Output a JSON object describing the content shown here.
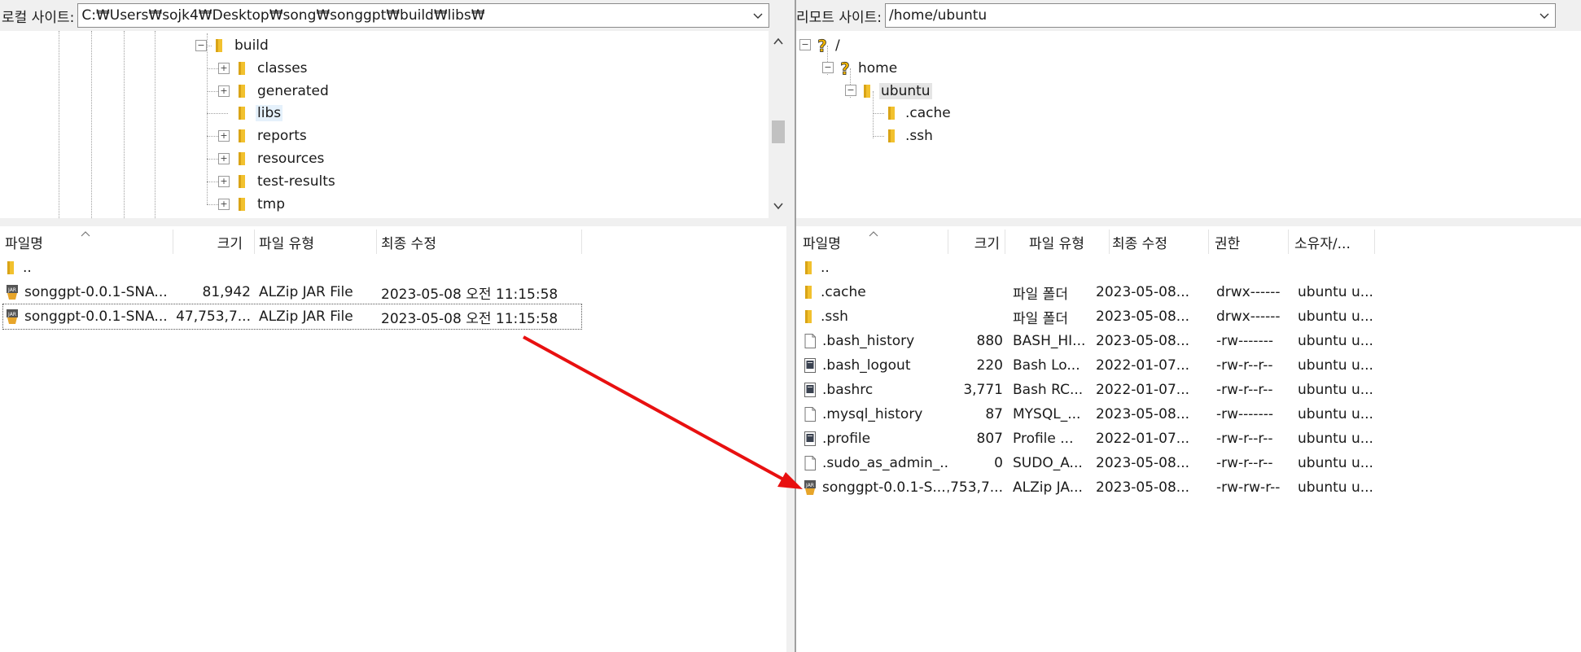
{
  "local": {
    "site_label": "로컬 사이트:",
    "site_path": "C:₩Users₩sojk4₩Desktop₩song₩songgpt₩build₩libs₩",
    "tree": [
      {
        "label": "build",
        "level": 0,
        "expanded": true
      },
      {
        "label": "classes",
        "level": 1,
        "expander": "+"
      },
      {
        "label": "generated",
        "level": 1,
        "expander": "+"
      },
      {
        "label": "libs",
        "level": 1,
        "selected": true
      },
      {
        "label": "reports",
        "level": 1,
        "expander": "+"
      },
      {
        "label": "resources",
        "level": 1,
        "expander": "+"
      },
      {
        "label": "test-results",
        "level": 1,
        "expander": "+"
      },
      {
        "label": "tmp",
        "level": 1,
        "expander": "+"
      }
    ],
    "columns": {
      "name": "파일명",
      "size": "크기",
      "type": "파일 유형",
      "modified": "최종 수정"
    },
    "files": [
      {
        "name": "..",
        "icon": "folder-icon"
      },
      {
        "name": "songgpt-0.0.1-SNA...",
        "size": "81,942",
        "type": "ALZip JAR File",
        "modified": "2023-05-08 오전 11:15:58",
        "icon": "jar-file-icon"
      },
      {
        "name": "songgpt-0.0.1-SNA...",
        "size": "47,753,7...",
        "type": "ALZip JAR File",
        "modified": "2023-05-08 오전 11:15:58",
        "icon": "jar-file-icon",
        "focused": true
      }
    ]
  },
  "remote": {
    "site_label": "리모트 사이트:",
    "site_path": "/home/ubuntu",
    "tree": [
      {
        "label": "/",
        "level": 0,
        "icon": "question-icon"
      },
      {
        "label": "home",
        "level": 1,
        "icon": "question-icon"
      },
      {
        "label": "ubuntu",
        "level": 2,
        "icon": "folder-icon",
        "selected": true
      },
      {
        "label": ".cache",
        "level": 3,
        "icon": "folder-icon"
      },
      {
        "label": ".ssh",
        "level": 3,
        "icon": "folder-icon"
      }
    ],
    "columns": {
      "name": "파일명",
      "size": "크기",
      "type": "파일 유형",
      "modified": "최종 수정",
      "perm": "권한",
      "owner": "소유자/..."
    },
    "files": [
      {
        "name": "..",
        "icon": "folder-icon"
      },
      {
        "name": ".cache",
        "size": "",
        "type": "파일 폴더",
        "modified": "2023-05-08...",
        "perm": "drwx------",
        "owner": "ubuntu u...",
        "icon": "folder-icon"
      },
      {
        "name": ".ssh",
        "size": "",
        "type": "파일 폴더",
        "modified": "2023-05-08...",
        "perm": "drwx------",
        "owner": "ubuntu u...",
        "icon": "folder-icon"
      },
      {
        "name": ".bash_history",
        "size": "880",
        "type": "BASH_HI...",
        "modified": "2023-05-08...",
        "perm": "-rw-------",
        "owner": "ubuntu u...",
        "icon": "blank-file-icon"
      },
      {
        "name": ".bash_logout",
        "size": "220",
        "type": "Bash Lo...",
        "modified": "2022-01-07...",
        "perm": "-rw-r--r--",
        "owner": "ubuntu u...",
        "icon": "script-file-icon"
      },
      {
        "name": ".bashrc",
        "size": "3,771",
        "type": "Bash RC...",
        "modified": "2022-01-07...",
        "perm": "-rw-r--r--",
        "owner": "ubuntu u...",
        "icon": "script-file-icon"
      },
      {
        "name": ".mysql_history",
        "size": "87",
        "type": "MYSQL_...",
        "modified": "2023-05-08...",
        "perm": "-rw-------",
        "owner": "ubuntu u...",
        "icon": "blank-file-icon"
      },
      {
        "name": ".profile",
        "size": "807",
        "type": "Profile ...",
        "modified": "2022-01-07...",
        "perm": "-rw-r--r--",
        "owner": "ubuntu u...",
        "icon": "script-file-icon"
      },
      {
        "name": ".sudo_as_admin_...",
        "size": "0",
        "type": "SUDO_A...",
        "modified": "2023-05-08...",
        "perm": "-rw-r--r--",
        "owner": "ubuntu u...",
        "icon": "blank-file-icon"
      },
      {
        "name": "songgpt-0.0.1-S...",
        "size": "47,753,7...",
        "type": "ALZip JA...",
        "modified": "2023-05-08...",
        "perm": "-rw-rw-r--",
        "owner": "ubuntu u...",
        "icon": "jar-file-icon"
      }
    ]
  },
  "colors": {
    "arrow": "#e81010",
    "folder": "#f2c12e",
    "question": "#f0b400",
    "selection": "#cce8ff"
  }
}
